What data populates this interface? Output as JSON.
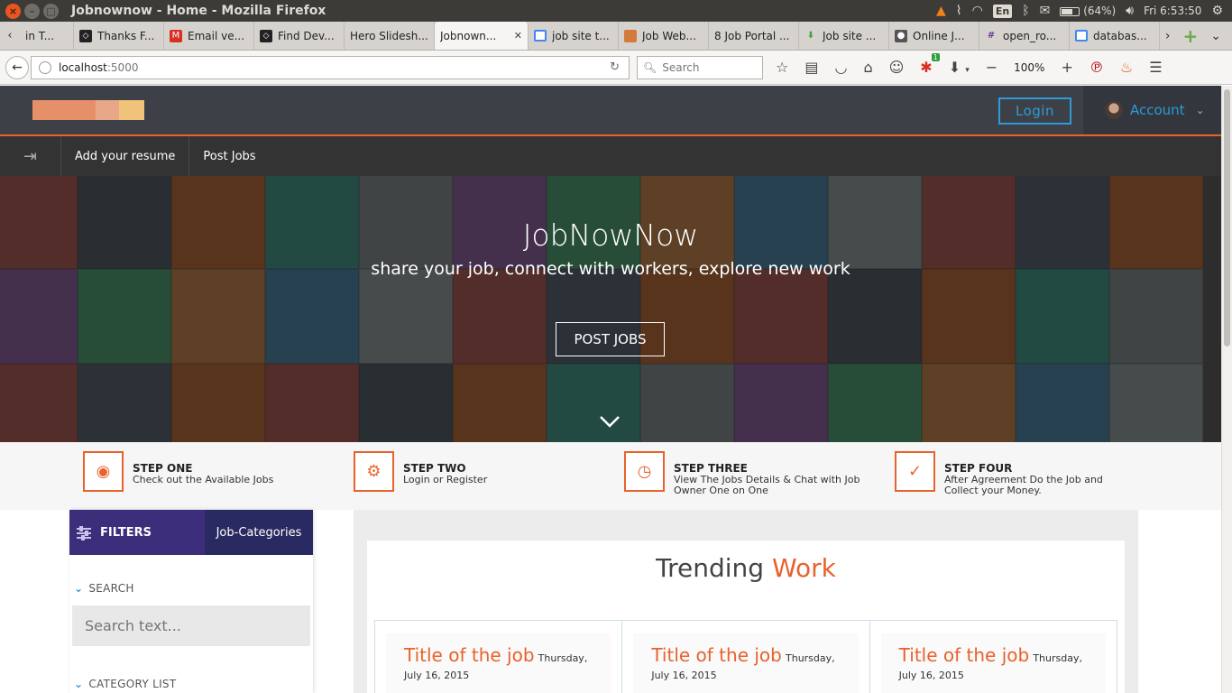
{
  "os": {
    "window_title": "Jobnownow - Home - Mozilla Firefox",
    "battery": "(64%)",
    "clock": "Fri 6:53:50",
    "lang": "En"
  },
  "tabs": [
    {
      "label": "in T...",
      "favicon": "unknown"
    },
    {
      "label": "Thanks F...",
      "favicon": "code-icon"
    },
    {
      "label": "Email ve...",
      "favicon": "gmail-icon"
    },
    {
      "label": "Find Dev...",
      "favicon": "code-icon"
    },
    {
      "label": "Hero Slidesh...",
      "favicon": "none"
    },
    {
      "label": "Jobnown...",
      "favicon": "none",
      "active": true
    },
    {
      "label": "job site t...",
      "favicon": "google-icon"
    },
    {
      "label": "Job Web...",
      "favicon": "site-icon"
    },
    {
      "label": "8 Job Portal ...",
      "favicon": "none"
    },
    {
      "label": "Job site ...",
      "favicon": "download-icon"
    },
    {
      "label": "Online J...",
      "favicon": "owl-icon"
    },
    {
      "label": "open_ro...",
      "favicon": "hash-icon"
    },
    {
      "label": "databas...",
      "favicon": "google-icon"
    }
  ],
  "nav": {
    "url_host": "localhost",
    "url_port": ":5000",
    "search_placeholder": "Search",
    "zoom": "100%"
  },
  "site": {
    "login_label": "Login",
    "account_label": "Account",
    "nav_links": [
      "Add your resume",
      "Post Jobs"
    ],
    "hero_title": "JobNowNow",
    "hero_subtitle": "share your job, connect with workers, explore new work",
    "hero_button": "POST JOBS",
    "steps": [
      {
        "title": "STEP ONE",
        "desc": "Check out the Available Jobs",
        "icon": "eye-icon"
      },
      {
        "title": "STEP TWO",
        "desc": "Login or Register",
        "icon": "gears-icon"
      },
      {
        "title": "STEP THREE",
        "desc": "View The Jobs Details & Chat with Job Owner One on One",
        "icon": "clock-icon"
      },
      {
        "title": "STEP FOUR",
        "desc": "After Agreement Do the Job and Collect your Money.",
        "icon": "check-circle-icon"
      }
    ],
    "filters_label": "FILTERS",
    "job_categories_label": "Job-Categories",
    "search_section": "SEARCH",
    "search_placeholder": "Search text...",
    "category_section": "CATEGORY LIST",
    "trending_title_main": "Trending",
    "trending_title_accent": "Work",
    "jobs": [
      {
        "title": "Title of the job",
        "date_day": "Thursday,",
        "date_rest": "July 16, 2015"
      },
      {
        "title": "Title of the job",
        "date_day": "Thursday,",
        "date_rest": "July 16, 2015"
      },
      {
        "title": "Title of the job",
        "date_day": "Thursday,",
        "date_rest": "July 16, 2015"
      }
    ]
  },
  "colors": {
    "accent": "#e8622c",
    "link_blue": "#2e9ad6",
    "purple": "#3d2e7c",
    "header_bg": "#3d4147"
  }
}
